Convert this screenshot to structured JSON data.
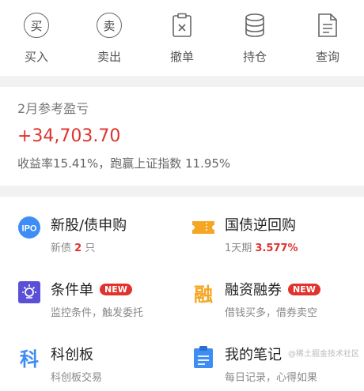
{
  "actions": [
    {
      "label": "买入",
      "icon": "buy-icon",
      "glyph": "买"
    },
    {
      "label": "卖出",
      "icon": "sell-icon",
      "glyph": "卖"
    },
    {
      "label": "撤单",
      "icon": "cancel-order-icon"
    },
    {
      "label": "持仓",
      "icon": "position-icon"
    },
    {
      "label": "查询",
      "icon": "query-icon"
    }
  ],
  "summary": {
    "title": "2月参考盈亏",
    "pnl": "+34,703.70",
    "sub": "收益率15.41%，跑赢上证指数 11.95%"
  },
  "services": {
    "ipo": {
      "icon_text": "IPO",
      "name": "新股/债申购",
      "desc_prefix": "新债",
      "desc_value": "2",
      "desc_suffix": "只"
    },
    "repo": {
      "name": "国债逆回购",
      "desc_prefix": "1天期",
      "desc_value": "3.577%"
    },
    "condition": {
      "name": "条件单",
      "badge": "NEW",
      "desc": "监控条件，触发委托"
    },
    "margin": {
      "name": "融资融券",
      "badge": "NEW",
      "desc": "借钱买多，借券卖空",
      "icon_text": "融"
    },
    "star": {
      "name": "科创板",
      "desc": "科创板交易",
      "icon_text": "科"
    },
    "notes": {
      "name": "我的笔记",
      "desc": "每日记录，心得如果"
    }
  },
  "colors": {
    "accent_red": "#e0332e",
    "blue": "#3d8df5",
    "orange": "#f5a623",
    "purple": "#5b4fd6"
  },
  "watermark": "@稀土掘金技术社区"
}
